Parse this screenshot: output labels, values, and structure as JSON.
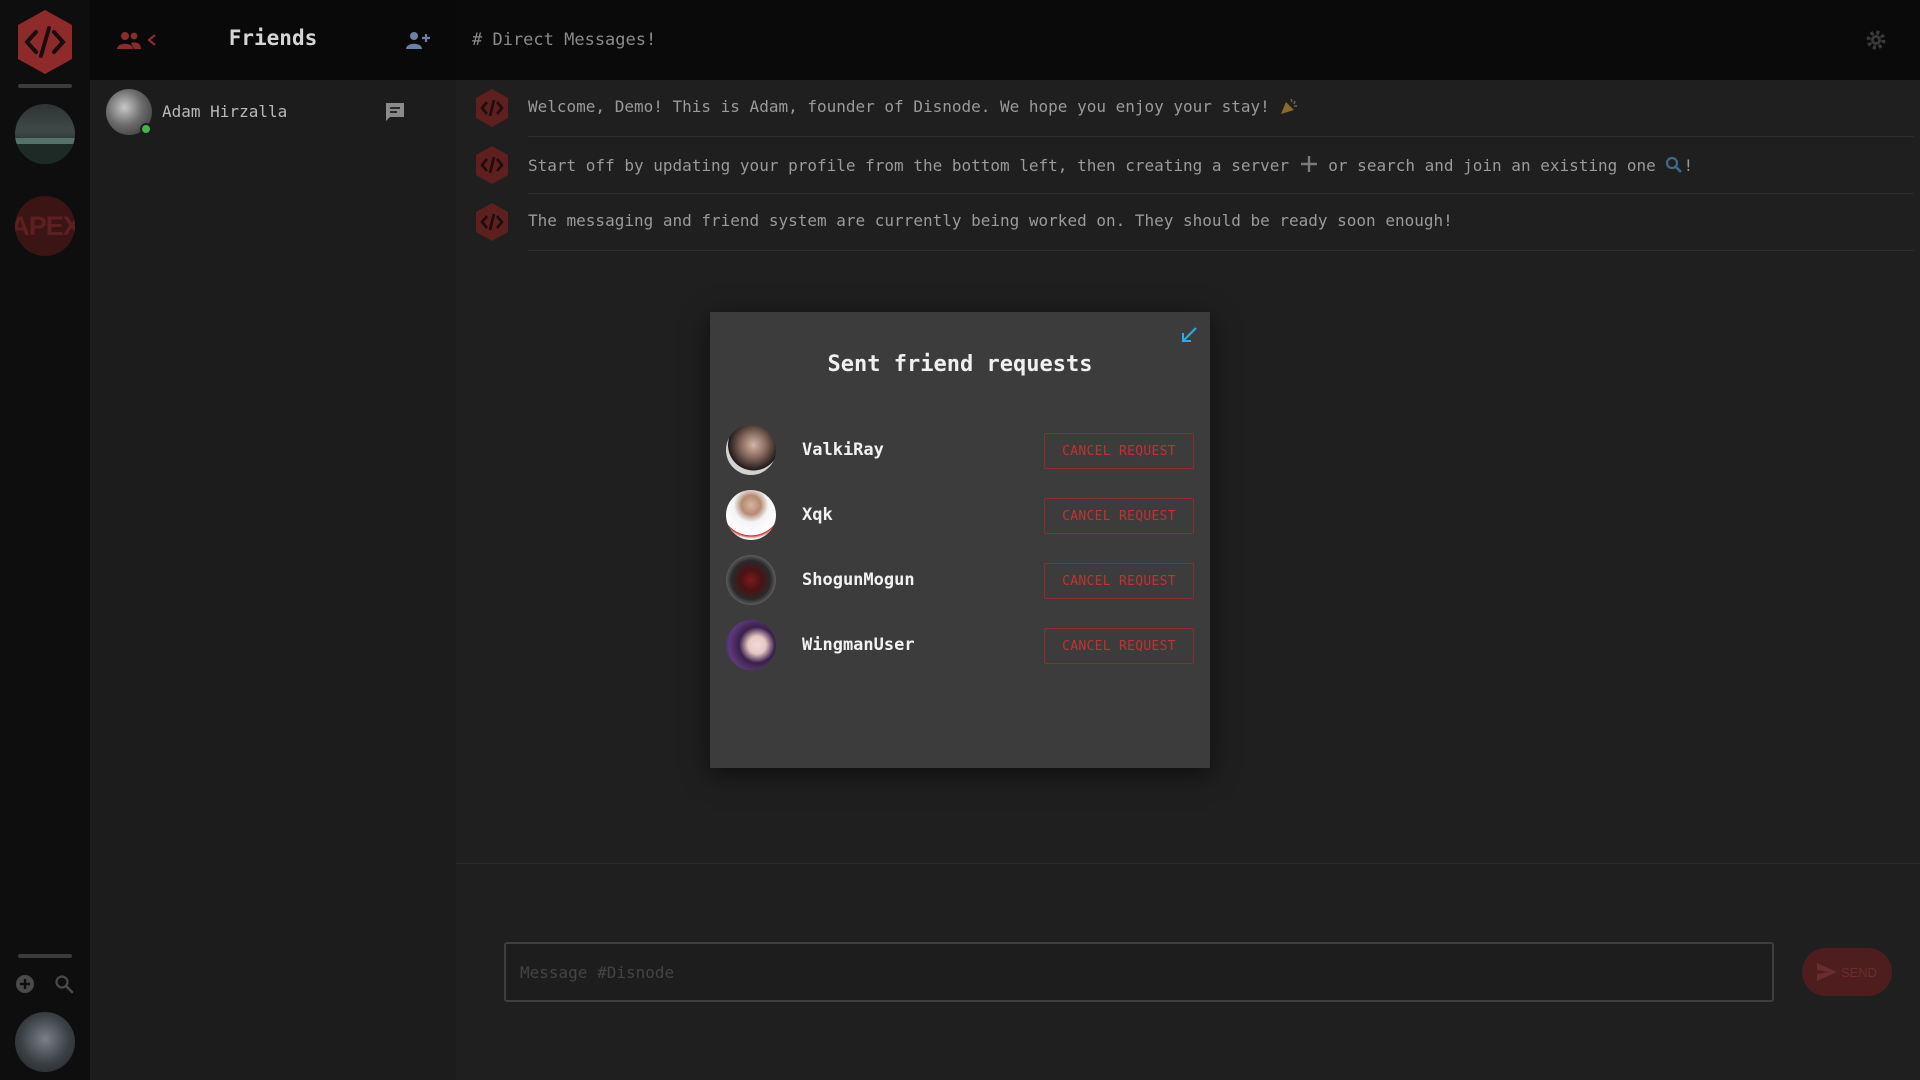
{
  "rail": {
    "logo_icon": "disnode-code-logo-icon",
    "servers": [
      {
        "icon": "lake-server-icon"
      },
      {
        "label": "APEX",
        "icon": "apex-server-icon"
      }
    ],
    "actions": [
      {
        "icon": "add-server-icon"
      },
      {
        "icon": "search-icon"
      }
    ],
    "user_avatar_icon": "user-avatar-icon"
  },
  "friends_panel": {
    "title": "Friends",
    "friends": [
      {
        "name": "Adam Hirzalla",
        "status": "online"
      }
    ]
  },
  "main": {
    "channel_title": "# Direct Messages!",
    "messages": [
      {
        "text": "Welcome, Demo! This is Adam, founder of Disnode. We hope you enjoy your stay!",
        "emoji": "party-popper-icon"
      },
      {
        "text_before": "Start off by updating your profile from the bottom left, then creating a server",
        "text_middle": "or search and join an existing one",
        "text_after": "!"
      },
      {
        "text": "The messaging and friend system are currently being worked on. They should be ready soon enough!"
      }
    ],
    "input_placeholder": "Message #Disnode",
    "send_label": "SEND"
  },
  "modal": {
    "title": "Sent friend requests",
    "cancel_label": "CANCEL REQUEST",
    "requests": [
      {
        "name": "ValkiRay"
      },
      {
        "name": "Xqk"
      },
      {
        "name": "ShogunMogun"
      },
      {
        "name": "WingmanUser"
      }
    ]
  },
  "colors": {
    "accent_red": "#c53030",
    "link_blue": "#2fa9e8",
    "online_green": "#43b54a"
  }
}
